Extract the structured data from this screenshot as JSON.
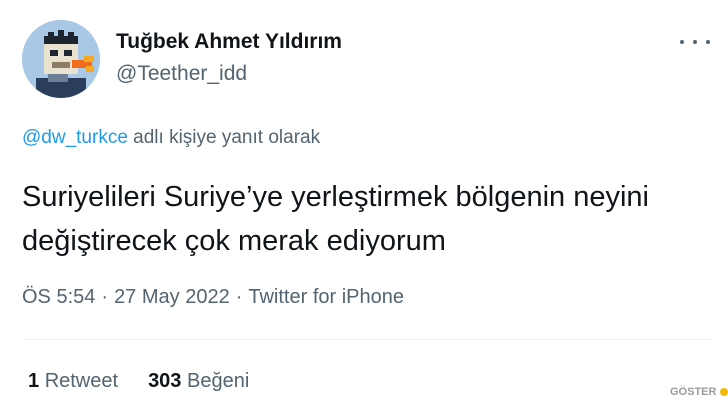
{
  "author": {
    "display_name": "Tuğbek Ahmet Yıldırım",
    "handle": "@Teether_idd",
    "avatar_icon": "pixel-art-ape-avatar"
  },
  "tweet": {
    "reply_to_mention": "@dw_turkce",
    "reply_suffix": " adlı kişiye yanıt olarak",
    "text": "Suriyelileri Suriye’ye yerleştirmek bölgenin neyini değiştirecek çok merak ediyorum",
    "time": "ÖS 5:54",
    "date": "27 May 2022",
    "source": "Twitter for iPhone",
    "separator": "·"
  },
  "stats": {
    "retweet_count": "1",
    "retweet_label": "Retweet",
    "like_count": "303",
    "like_label": "Beğeni"
  },
  "watermark": {
    "text": "GÖSTER"
  },
  "colors": {
    "primary_text": "#0f1419",
    "secondary_text": "#536471",
    "link": "#1d9bf0",
    "divider": "#eff3f4"
  }
}
